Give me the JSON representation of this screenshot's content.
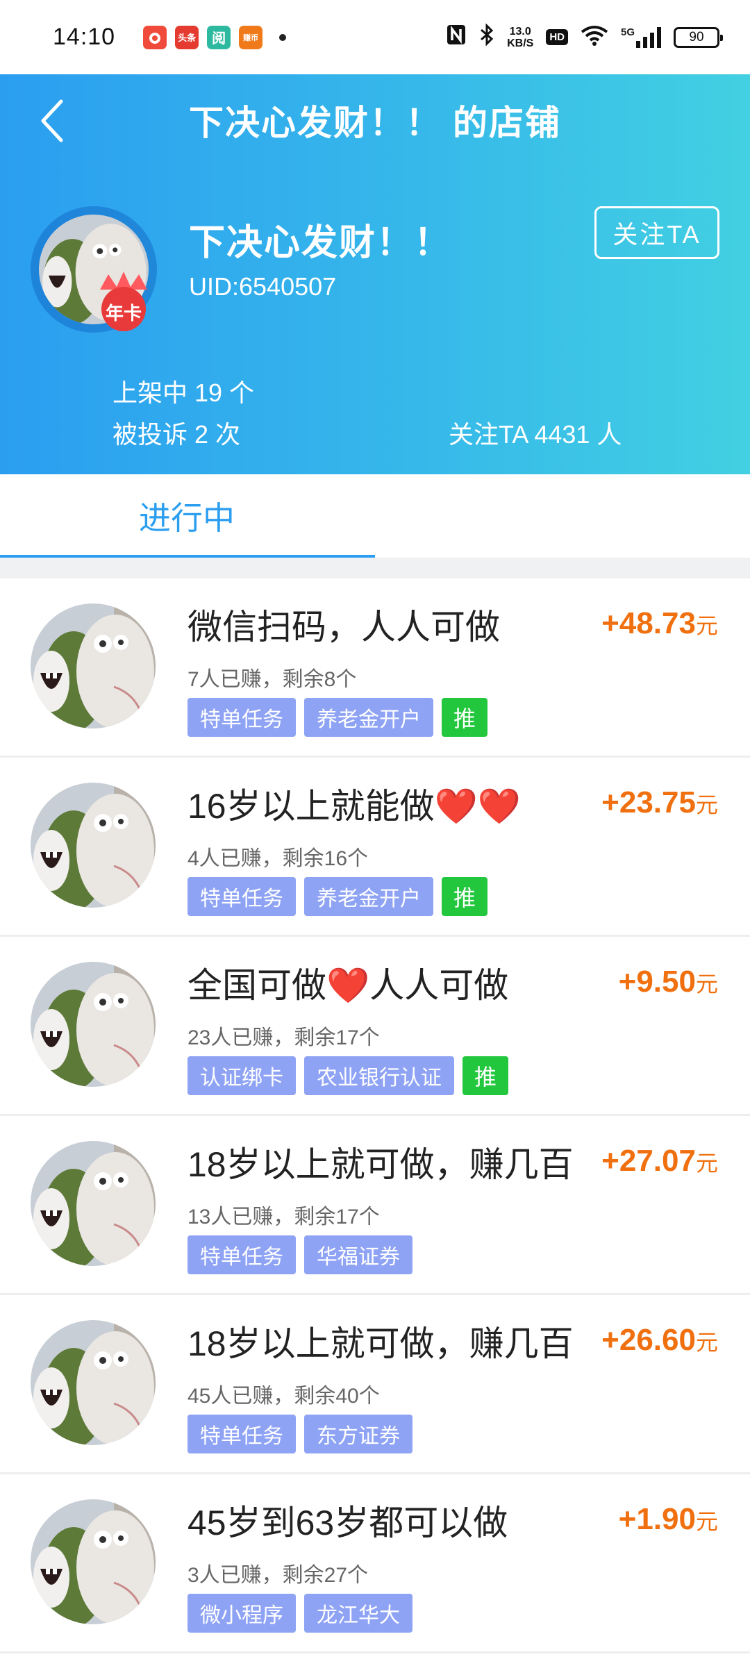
{
  "status_bar": {
    "time": "14:10",
    "notification_icons": [
      {
        "name": "app-icon-red",
        "color": "#f04a3a",
        "text": ""
      },
      {
        "name": "toutiao-icon",
        "color": "#e43a2f",
        "text": "头条"
      },
      {
        "name": "reader-icon",
        "color": "#2db9a0",
        "text": "阅"
      },
      {
        "name": "coin-app-icon",
        "color": "#f07a1a",
        "text": "赚币"
      }
    ],
    "net_speed_value": "13.0",
    "net_speed_unit": "KB/S",
    "hd_label": "HD",
    "network_type": "5G",
    "battery": "90"
  },
  "header": {
    "title": "下决心发财！！ 的店铺",
    "shop_name": "下决心发财！！",
    "uid": "UID:6540507",
    "badge_text": "年卡",
    "follow_label": "关注TA",
    "listed": "上架中 19 个",
    "complaints": "被投诉 2 次",
    "followers": "关注TA 4431 人",
    "colors": {
      "gradient_start": "#2b9ef0",
      "gradient_end": "#42d0e2"
    }
  },
  "tabs": {
    "active_label": "进行中",
    "active_color": "#2b9ef0"
  },
  "tasks": [
    {
      "title": "微信扫码，人人可做",
      "progress": "7人已赚，剩余8个",
      "reward": "+48.73",
      "unit": "元",
      "tags": [
        "特单任务",
        "养老金开户"
      ],
      "recommend": "推"
    },
    {
      "title": "16岁以上就能做❤️❤️",
      "progress": "4人已赚，剩余16个",
      "reward": "+23.75",
      "unit": "元",
      "tags": [
        "特单任务",
        "养老金开户"
      ],
      "recommend": "推"
    },
    {
      "title": "全国可做❤️人人可做",
      "progress": "23人已赚，剩余17个",
      "reward": "+9.50",
      "unit": "元",
      "tags": [
        "认证绑卡",
        "农业银行认证"
      ],
      "recommend": "推"
    },
    {
      "title": "18岁以上就可做，赚几百",
      "progress": "13人已赚，剩余17个",
      "reward": "+27.07",
      "unit": "元",
      "tags": [
        "特单任务",
        "华福证券"
      ],
      "recommend": ""
    },
    {
      "title": "18岁以上就可做，赚几百",
      "progress": "45人已赚，剩余40个",
      "reward": "+26.60",
      "unit": "元",
      "tags": [
        "特单任务",
        "东方证券"
      ],
      "recommend": ""
    },
    {
      "title": "45岁到63岁都可以做",
      "progress": "3人已赚，剩余27个",
      "reward": "+1.90",
      "unit": "元",
      "tags": [
        "微小程序",
        "龙江华大"
      ],
      "recommend": ""
    }
  ],
  "reward_color": "#f07010",
  "tag_color": "#8fa3f5",
  "recommend_color": "#22c73e"
}
